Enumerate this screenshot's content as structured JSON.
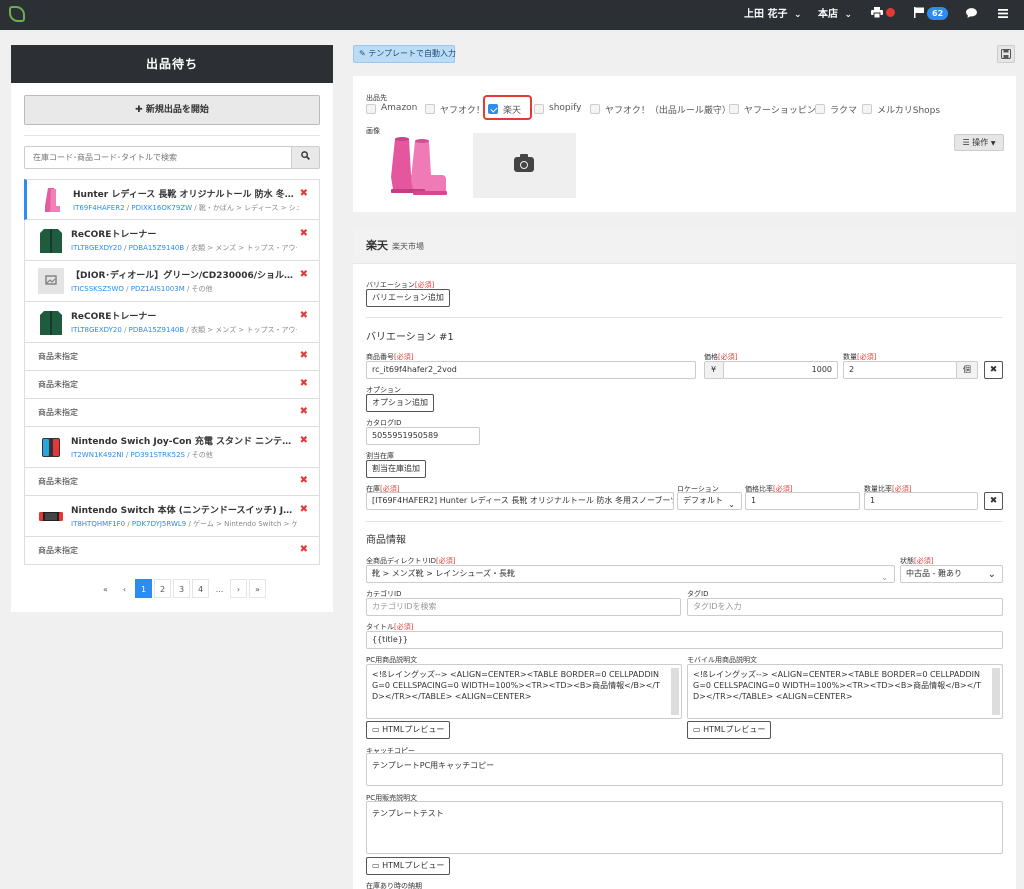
{
  "topbar": {
    "user_name": "上田 花子",
    "store": "本店",
    "flag_count": "62",
    "user_caret": "⌄",
    "store_caret": "⌄"
  },
  "sidebar": {
    "title": "出品待ち",
    "new_listing_label": "新規出品を開始",
    "search_placeholder": "在庫コード･商品コード･タイトルで検索",
    "items": [
      {
        "title": "Hunter レディース 長靴 オリジナルトール 防水 冬用スノーブーツ",
        "code": "IT69F4HAFER2",
        "pd": "PDIXK16OK79ZW",
        "cat": " / 靴・かばん > レディース > シューズ > ..."
      },
      {
        "title": "ReCOREトレーナー",
        "code": "ITLT8GEXDY20",
        "pd": "PDBA15Z9140B",
        "cat": " / 衣類 > メンズ > トップス・アウター"
      },
      {
        "title": "【DIOR･ディオール】グリーン/CD230006/ショルダーバッグ",
        "code": "ITICSSKSZ5WO",
        "pd": "PDZ1AIS1003M",
        "cat": " / その他"
      },
      {
        "title": "ReCOREトレーナー",
        "code": "ITLT8GEXDY20",
        "pd": "PDBA15Z9140B",
        "cat": " / 衣類 > メンズ > トップス・アウター"
      },
      {
        "short": "商品未指定"
      },
      {
        "short": "商品未指定"
      },
      {
        "short": "商品未指定"
      },
      {
        "title": "Nintendo Swich Joy-Con 充電 スタンド ニンテンドースイッチ",
        "code": "IT2WN1K492NI",
        "pd": "PD391STRK52S",
        "cat": " / その他"
      },
      {
        "short": "商品未指定"
      },
      {
        "title": "Nintendo Switch 本体 (ニンテンドースイッチ) Joy-Con(L) ネオン",
        "code": "IT8HTQHMF1F0",
        "pd": "PDK7DYJ5RWL9",
        "cat": " / ゲーム > Nintendo Switch > ゲー..."
      },
      {
        "short": "商品未指定"
      }
    ],
    "delete_mark": "✖",
    "pager": [
      "«",
      "‹",
      "1",
      "2",
      "3",
      "4",
      "...",
      "›",
      "»"
    ]
  },
  "toolbar": {
    "template_label": "テンプレートで自動入力"
  },
  "top_card": {
    "channel_label": "出品先",
    "channels": [
      {
        "label": "Amazon",
        "checked": false
      },
      {
        "label": "ヤフオク！",
        "checked": false
      },
      {
        "label": "楽天",
        "checked": true
      },
      {
        "label": "shopify",
        "checked": false
      },
      {
        "label": "ヤフオク！（出品ルール厳守）",
        "checked": false
      },
      {
        "label": "ヤフーショッピング",
        "checked": false
      },
      {
        "label": "ラクマ",
        "checked": false
      },
      {
        "label": "メルカリShops",
        "checked": false
      }
    ],
    "image_label": "画像",
    "ops_label": "操作"
  },
  "rakuten": {
    "title": "楽天",
    "subtitle": "楽天市場",
    "variation_label": "バリエーション",
    "required": "[必須]",
    "add_variation": "バリエーション追加",
    "variation_heading": "バリエーション #1",
    "item_number_label": "商品番号",
    "item_number": "rc_it69f4hafer2_2vod",
    "price_label": "価格",
    "yen": "¥",
    "price": "1000",
    "qty_label": "数量",
    "qty": "2",
    "qty_unit": "個",
    "option_label": "オプション",
    "add_option": "オプション追加",
    "catalog_label": "カタログID",
    "catalog_id": "5055951950589",
    "alloc_label": "割当在庫",
    "add_alloc": "割当在庫追加",
    "stock_label": "在庫",
    "stock_value": "[IT69F4HAFER2] Hunter レディース 長靴 オリジナルトール 防水 冬用スノーブーツ",
    "location_label": "ロケーション",
    "location_value": "デフォルト",
    "price_ratio_label": "価格比率",
    "price_ratio": "1",
    "qty_ratio_label": "数量比率",
    "qty_ratio": "1",
    "product_info_heading": "商品情報",
    "dir_label": "全商品ディレクトリID",
    "dir_value": "靴 > メンズ靴 > レインシューズ・長靴",
    "condition_label": "状態",
    "condition_value": "中古品 - 難あり",
    "category_label": "カテゴリID",
    "category_placeholder": "カテゴリIDを検索",
    "tag_label": "タグID",
    "tag_placeholder": "タグIDを入力",
    "title_label": "タイトル",
    "title_value": "{{title}}",
    "pc_desc_label": "PC用商品説明文",
    "pc_desc": "<!ßレイングッズ--> <ALIGN=CENTER><TABLE BORDER=0 CELLPADDING=0 CELLSPACING=0 WIDTH=100%><TR><TD><B>商品情報</B></TD></TR></TABLE> <ALIGN=CENTER>",
    "mobile_desc_label": "モバイル用商品説明文",
    "mobile_desc": "<!ßレイングッズ--> <ALIGN=CENTER><TABLE BORDER=0 CELLPADDING=0 CELLSPACING=0 WIDTH=100%><TR><TD><B>商品情報</B></TD></TR></TABLE> <ALIGN=CENTER>",
    "html_preview": "HTMLプレビュー",
    "catch_label": "キャッチコピー",
    "catch_value": "テンプレートPC用キャッチコピー",
    "pc_sales_label": "PC用販売説明文",
    "pc_sales_value": "テンプレートテスト",
    "stock_delivery_label": "在庫あり時の納期"
  },
  "colors": {
    "accent": "#2d8cf0",
    "danger": "#e53935",
    "dark": "#2c2f33"
  }
}
